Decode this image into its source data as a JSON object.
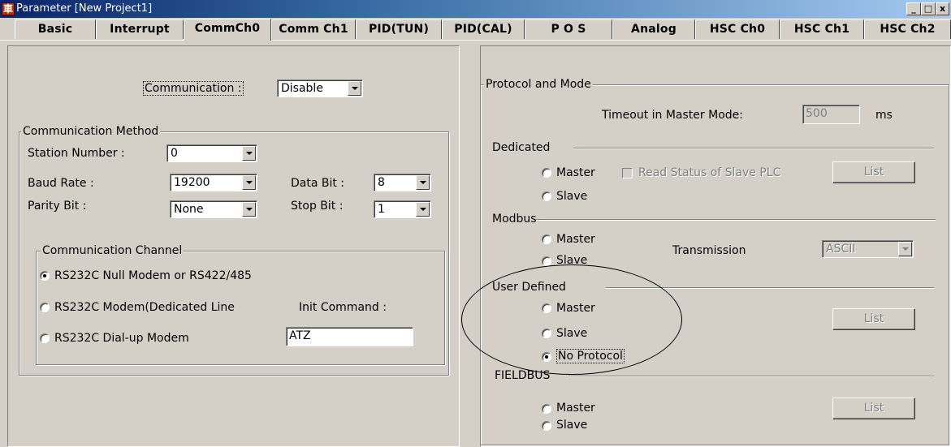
{
  "window": {
    "title": "Parameter [New Project1]",
    "icon": "app-icon",
    "controls": {
      "minimize": "_",
      "maximize": "□",
      "close": "x"
    }
  },
  "tabs": [
    "Basic",
    "Interrupt",
    "CommCh0",
    "Comm Ch1",
    "PID(TUN)",
    "PID(CAL)",
    "P O S",
    "Analog",
    "HSC Ch0",
    "HSC Ch1",
    "HSC Ch2"
  ],
  "active_tab": "CommCh0",
  "communication": {
    "label": "Communication :",
    "value": "Disable"
  },
  "method": {
    "title": "Communication Method",
    "station_label": "Station Number :",
    "station_value": "0",
    "baud_label": "Baud Rate :",
    "baud_value": "19200",
    "databit_label": "Data Bit :",
    "databit_value": "8",
    "parity_label": "Parity Bit :",
    "parity_value": "None",
    "stopbit_label": "Stop Bit :",
    "stopbit_value": "1"
  },
  "channel": {
    "title": "Communication Channel",
    "opt1": "RS232C Null Modem or RS422/485",
    "opt2": "RS232C Modem(Dedicated Line",
    "init_label": "Init Command :",
    "opt3": "RS232C Dial-up Modem",
    "init_value": "ATZ",
    "selected": "opt1"
  },
  "protocol": {
    "title": "Protocol and Mode",
    "timeout_label": "Timeout in Master Mode:",
    "timeout_value": "500",
    "timeout_unit": "ms",
    "dedicated": {
      "title": "Dedicated",
      "master": "Master",
      "slave": "Slave",
      "read_status": "Read Status of Slave PLC",
      "list": "List"
    },
    "modbus": {
      "title": "Modbus",
      "master": "Master",
      "slave": "Slave",
      "transmission_label": "Transmission",
      "transmission_value": "ASCII"
    },
    "user_defined": {
      "title": "User Defined",
      "master": "Master",
      "slave": "Slave",
      "no_protocol": "No Protocol",
      "list": "List",
      "selected": "no_protocol"
    },
    "fieldbus": {
      "title": "FIELDBUS",
      "master": "Master",
      "slave": "Slave",
      "list": "List"
    }
  }
}
